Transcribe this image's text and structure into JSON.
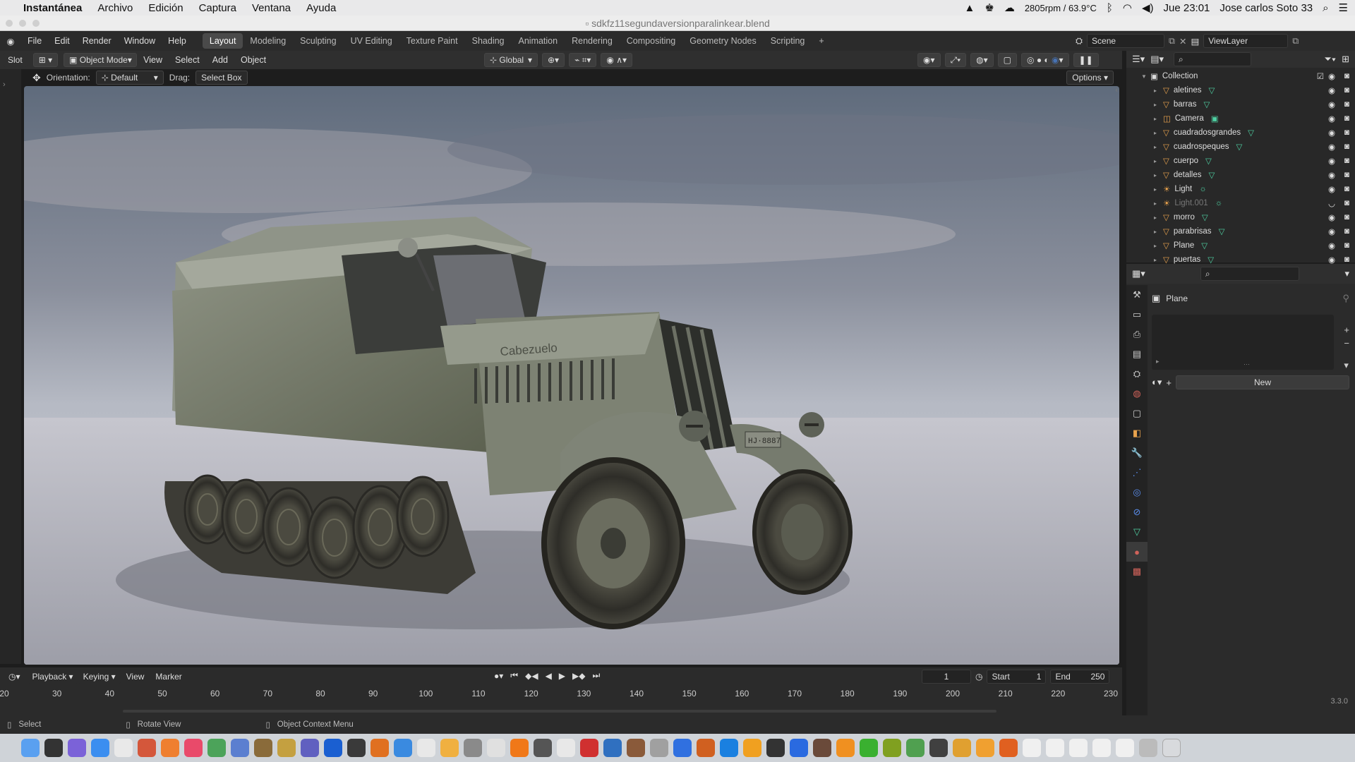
{
  "menubar": {
    "app": "Instantánea",
    "items": [
      "Archivo",
      "Edición",
      "Captura",
      "Ventana",
      "Ayuda"
    ],
    "cpu": "2805rpm / 63.9°C",
    "clock": "Jue 23:01",
    "user": "Jose carlos Soto 33"
  },
  "window": {
    "title": "sdkfz11segundaversionparalinkear.blend"
  },
  "topbar": {
    "menus": [
      "File",
      "Edit",
      "Render",
      "Window",
      "Help"
    ],
    "workspaces": [
      "Layout",
      "Modeling",
      "Sculpting",
      "UV Editing",
      "Texture Paint",
      "Shading",
      "Animation",
      "Rendering",
      "Compositing",
      "Geometry Nodes",
      "Scripting"
    ],
    "active_workspace": "Layout",
    "add": "+",
    "scene": "Scene",
    "view_layer": "ViewLayer"
  },
  "viewport": {
    "slot": "Slot",
    "mode": "Object Mode",
    "menus": [
      "View",
      "Select",
      "Add",
      "Object"
    ],
    "transform": "Global",
    "orientation_label": "Orientation:",
    "orientation": "Default",
    "drag_label": "Drag:",
    "drag": "Select Box",
    "options": "Options",
    "plate_text": "Cabezuelo",
    "license_text": "HJ·8887"
  },
  "outliner": {
    "collection": "Collection",
    "items": [
      {
        "name": "aletines",
        "type": "mesh"
      },
      {
        "name": "barras",
        "type": "mesh"
      },
      {
        "name": "Camera",
        "type": "camera"
      },
      {
        "name": "cuadradosgrandes",
        "type": "mesh"
      },
      {
        "name": "cuadrospeques",
        "type": "mesh"
      },
      {
        "name": "cuerpo",
        "type": "mesh"
      },
      {
        "name": "detalles",
        "type": "mesh"
      },
      {
        "name": "Light",
        "type": "light"
      },
      {
        "name": "Light.001",
        "type": "light",
        "disabled": true
      },
      {
        "name": "morro",
        "type": "mesh"
      },
      {
        "name": "parabrisas",
        "type": "mesh"
      },
      {
        "name": "Plane",
        "type": "mesh"
      },
      {
        "name": "puertas",
        "type": "mesh"
      }
    ]
  },
  "properties": {
    "object": "Plane",
    "new_label": "New"
  },
  "timeline": {
    "menus": [
      "Playback",
      "Keying",
      "View",
      "Marker"
    ],
    "current_frame": "1",
    "start_label": "Start",
    "start": "1",
    "end_label": "End",
    "end": "250",
    "ticks": [
      "20",
      "30",
      "40",
      "50",
      "60",
      "70",
      "80",
      "90",
      "100",
      "110",
      "120",
      "130",
      "140",
      "150",
      "160",
      "170",
      "180",
      "190",
      "200",
      "210",
      "220",
      "230"
    ]
  },
  "status": {
    "select": "Select",
    "rotate": "Rotate View",
    "context": "Object Context Menu",
    "version": "3.3.0"
  },
  "colors": {
    "accent": "#4772b3",
    "mesh_icon": "#e8a24d",
    "vert_icon": "#4fd1a3"
  }
}
